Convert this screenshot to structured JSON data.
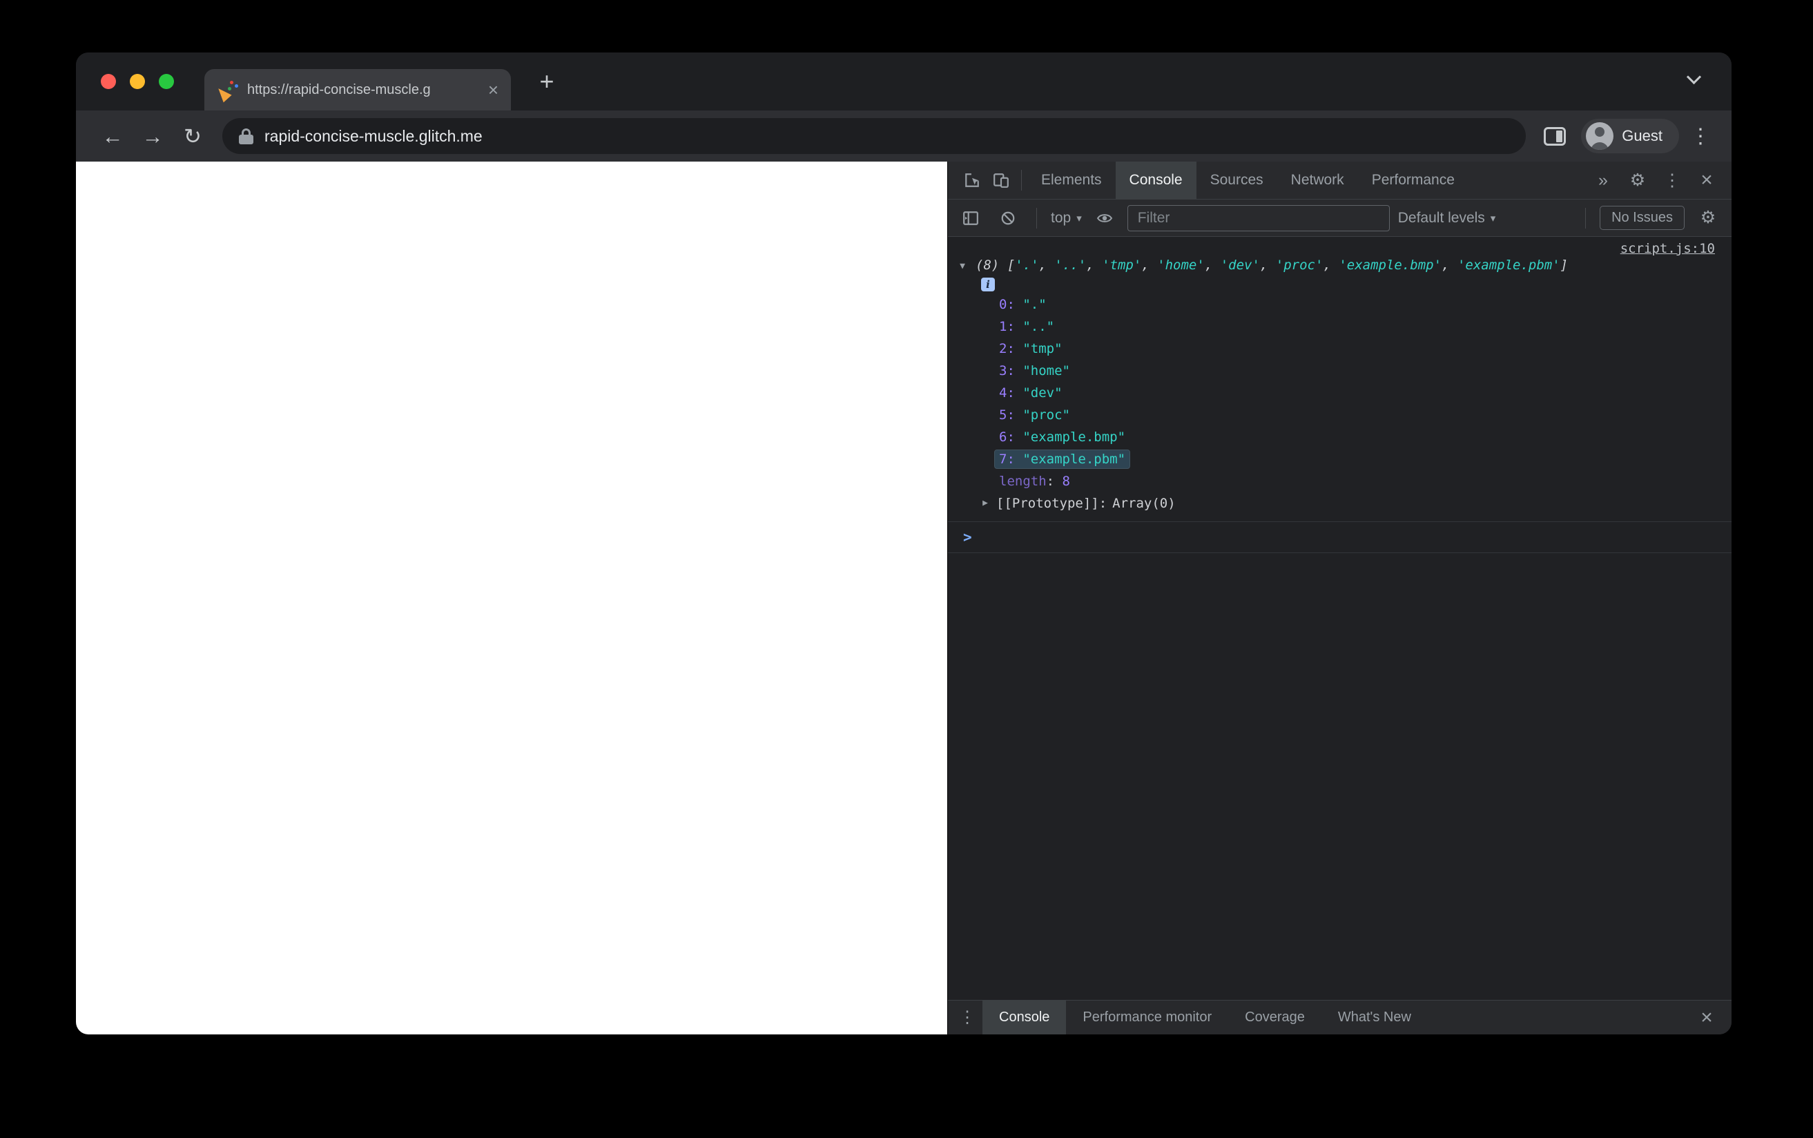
{
  "colors": {
    "devtools_bg": "#202124",
    "toolbar_bg": "#292a2d",
    "active_tab_bg": "#3c4043",
    "string_teal": "#35d4c7",
    "index_violet": "#9a7fff",
    "number_violet": "#9980ff",
    "link_gray": "#bdc1c6",
    "prompt_blue": "#7cacf8",
    "traffic_red": "#ff5f57",
    "traffic_yellow": "#febc2e",
    "traffic_green": "#28c840",
    "highlight_bg": "rgba(66,116,150,0.42)"
  },
  "icons": {
    "tab_favicon": "party-popper",
    "back": "←",
    "forward": "→",
    "reload": "↻",
    "kebab": "⋮",
    "gear": "⚙",
    "close": "×",
    "more": "»",
    "caret": "▾",
    "expand_open": "▼",
    "expand_closed": "▶",
    "prompt": ">",
    "new_tab": "+",
    "info": "i"
  },
  "browser": {
    "tab_title": "https://rapid-concise-muscle.g",
    "url": "rapid-concise-muscle.glitch.me",
    "profile_label": "Guest"
  },
  "devtools": {
    "tabs": [
      "Elements",
      "Console",
      "Sources",
      "Network",
      "Performance"
    ],
    "active_tab": "Console",
    "toolbar": {
      "context_label": "top",
      "filter_placeholder": "Filter",
      "levels_label": "Default levels",
      "issues_label": "No Issues"
    },
    "console": {
      "source_link": "script.js:10",
      "array_count": 8,
      "array_items": [
        ".",
        "..",
        "tmp",
        "home",
        "dev",
        "proc",
        "example.bmp",
        "example.pbm"
      ],
      "highlight_index": 7,
      "length_label": "length",
      "length_sep": ": ",
      "length_value": "8",
      "prototype_label": "[[Prototype]]:",
      "prototype_value": "Array(0)"
    },
    "drawer": {
      "tabs": [
        "Console",
        "Performance monitor",
        "Coverage",
        "What's New"
      ],
      "active_tab": "Console"
    }
  }
}
